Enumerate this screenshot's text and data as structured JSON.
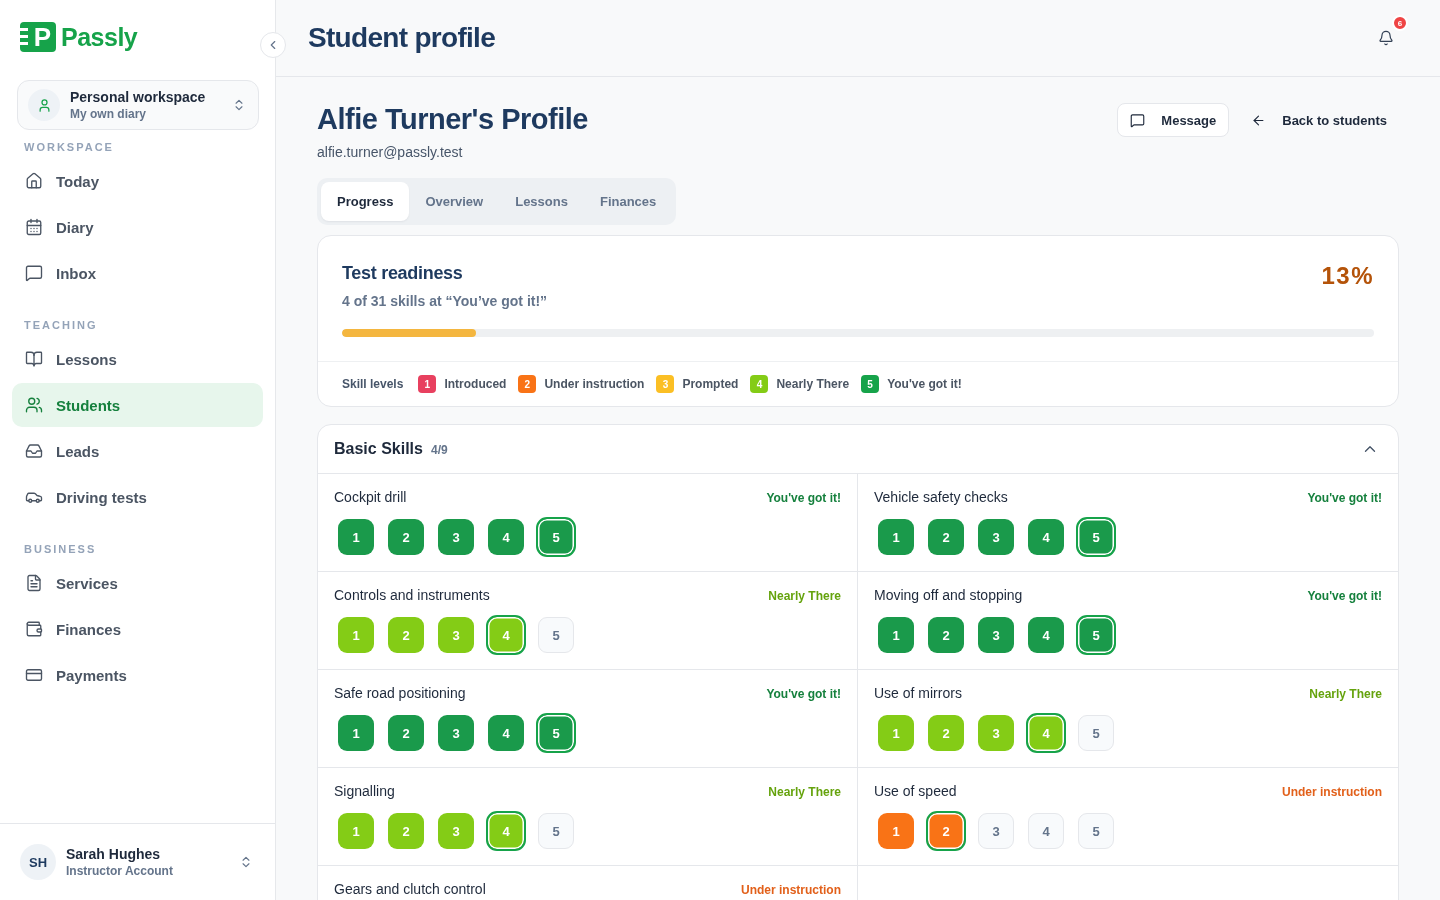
{
  "sidebar": {
    "brand": {
      "mark": "P",
      "name": "Passly"
    },
    "workspace_switcher": {
      "title": "Personal workspace",
      "subtitle": "My own diary"
    },
    "sections": [
      {
        "title": "WORKSPACE",
        "items": [
          {
            "label": "Today",
            "selected": false
          },
          {
            "label": "Diary",
            "selected": false
          },
          {
            "label": "Inbox",
            "selected": false
          }
        ]
      },
      {
        "title": "TEACHING",
        "items": [
          {
            "label": "Lessons",
            "selected": false
          },
          {
            "label": "Students",
            "selected": true
          },
          {
            "label": "Leads",
            "selected": false
          },
          {
            "label": "Driving tests",
            "selected": false
          }
        ]
      },
      {
        "title": "BUSINESS",
        "items": [
          {
            "label": "Services",
            "selected": false
          },
          {
            "label": "Finances",
            "selected": false
          },
          {
            "label": "Payments",
            "selected": false
          }
        ]
      }
    ],
    "user": {
      "initials": "SH",
      "name": "Sarah Hughes",
      "role": "Instructor Account"
    }
  },
  "header": {
    "title": "Student profile",
    "notifications": "6"
  },
  "profile": {
    "name": "Alfie Turner's Profile",
    "email": "alfie.turner@passly.test",
    "actions": [
      {
        "label": "Message",
        "kind": "outlined"
      },
      {
        "label": "Back to students",
        "kind": "plain"
      }
    ]
  },
  "tabs": [
    {
      "label": "Progress",
      "selected": true
    },
    {
      "label": "Overview",
      "selected": false
    },
    {
      "label": "Lessons",
      "selected": false
    },
    {
      "label": "Finances",
      "selected": false
    }
  ],
  "readiness": {
    "title": "Test readiness",
    "summary": "4 of 31 skills at “You’ve got it!”",
    "percent": "13%",
    "level": 0.13,
    "legend": {
      "label": "Skill levels",
      "items": [
        {
          "number": "1",
          "label": "Introduced",
          "color": "#e8405f"
        },
        {
          "number": "2",
          "label": "Under instruction",
          "color": "#f97316"
        },
        {
          "number": "3",
          "label": "Prompted",
          "color": "#fbbf24"
        },
        {
          "number": "4",
          "label": "Nearly There",
          "color": "#84cc16"
        },
        {
          "number": "5",
          "label": "You've got it!",
          "color": "#16a34a"
        }
      ]
    }
  },
  "skill_group": {
    "title": "Basic Skills",
    "count": "4/9",
    "expanded": true,
    "skills": [
      {
        "name": "Cockpit drill",
        "status": "You've got it!",
        "kind": "got-it",
        "steps": [
          {
            "label": "1",
            "filled": true,
            "selected": false
          },
          {
            "label": "2",
            "filled": true,
            "selected": false
          },
          {
            "label": "3",
            "filled": true,
            "selected": false
          },
          {
            "label": "4",
            "filled": true,
            "selected": false
          },
          {
            "label": "5",
            "filled": true,
            "selected": true
          }
        ]
      },
      {
        "name": "Vehicle safety checks",
        "status": "You've got it!",
        "kind": "got-it",
        "steps": [
          {
            "label": "1",
            "filled": true,
            "selected": false
          },
          {
            "label": "2",
            "filled": true,
            "selected": false
          },
          {
            "label": "3",
            "filled": true,
            "selected": false
          },
          {
            "label": "4",
            "filled": true,
            "selected": false
          },
          {
            "label": "5",
            "filled": true,
            "selected": true
          }
        ]
      },
      {
        "name": "Controls and instruments",
        "status": "Nearly There",
        "kind": "nearly-there",
        "steps": [
          {
            "label": "1",
            "filled": true,
            "selected": false
          },
          {
            "label": "2",
            "filled": true,
            "selected": false
          },
          {
            "label": "3",
            "filled": true,
            "selected": false
          },
          {
            "label": "4",
            "filled": true,
            "selected": true
          },
          {
            "label": "5",
            "filled": false,
            "selected": false
          }
        ]
      },
      {
        "name": "Moving off and stopping",
        "status": "You've got it!",
        "kind": "got-it",
        "steps": [
          {
            "label": "1",
            "filled": true,
            "selected": false
          },
          {
            "label": "2",
            "filled": true,
            "selected": false
          },
          {
            "label": "3",
            "filled": true,
            "selected": false
          },
          {
            "label": "4",
            "filled": true,
            "selected": false
          },
          {
            "label": "5",
            "filled": true,
            "selected": true
          }
        ]
      },
      {
        "name": "Safe road positioning",
        "status": "You've got it!",
        "kind": "got-it",
        "steps": [
          {
            "label": "1",
            "filled": true,
            "selected": false
          },
          {
            "label": "2",
            "filled": true,
            "selected": false
          },
          {
            "label": "3",
            "filled": true,
            "selected": false
          },
          {
            "label": "4",
            "filled": true,
            "selected": false
          },
          {
            "label": "5",
            "filled": true,
            "selected": true
          }
        ]
      },
      {
        "name": "Use of mirrors",
        "status": "Nearly There",
        "kind": "nearly-there",
        "steps": [
          {
            "label": "1",
            "filled": true,
            "selected": false
          },
          {
            "label": "2",
            "filled": true,
            "selected": false
          },
          {
            "label": "3",
            "filled": true,
            "selected": false
          },
          {
            "label": "4",
            "filled": true,
            "selected": true
          },
          {
            "label": "5",
            "filled": false,
            "selected": false
          }
        ]
      },
      {
        "name": "Signalling",
        "status": "Nearly There",
        "kind": "nearly-there",
        "steps": [
          {
            "label": "1",
            "filled": true,
            "selected": false
          },
          {
            "label": "2",
            "filled": true,
            "selected": false
          },
          {
            "label": "3",
            "filled": true,
            "selected": false
          },
          {
            "label": "4",
            "filled": true,
            "selected": true
          },
          {
            "label": "5",
            "filled": false,
            "selected": false
          }
        ]
      },
      {
        "name": "Use of speed",
        "status": "Under instruction",
        "kind": "under-instruction",
        "steps": [
          {
            "label": "1",
            "filled": true,
            "selected": false
          },
          {
            "label": "2",
            "filled": true,
            "selected": true
          },
          {
            "label": "3",
            "filled": false,
            "selected": false
          },
          {
            "label": "4",
            "filled": false,
            "selected": false
          },
          {
            "label": "5",
            "filled": false,
            "selected": false
          }
        ]
      },
      {
        "name": "Gears and clutch control",
        "status": "Under instruction",
        "kind": "under-instruction"
      }
    ]
  }
}
